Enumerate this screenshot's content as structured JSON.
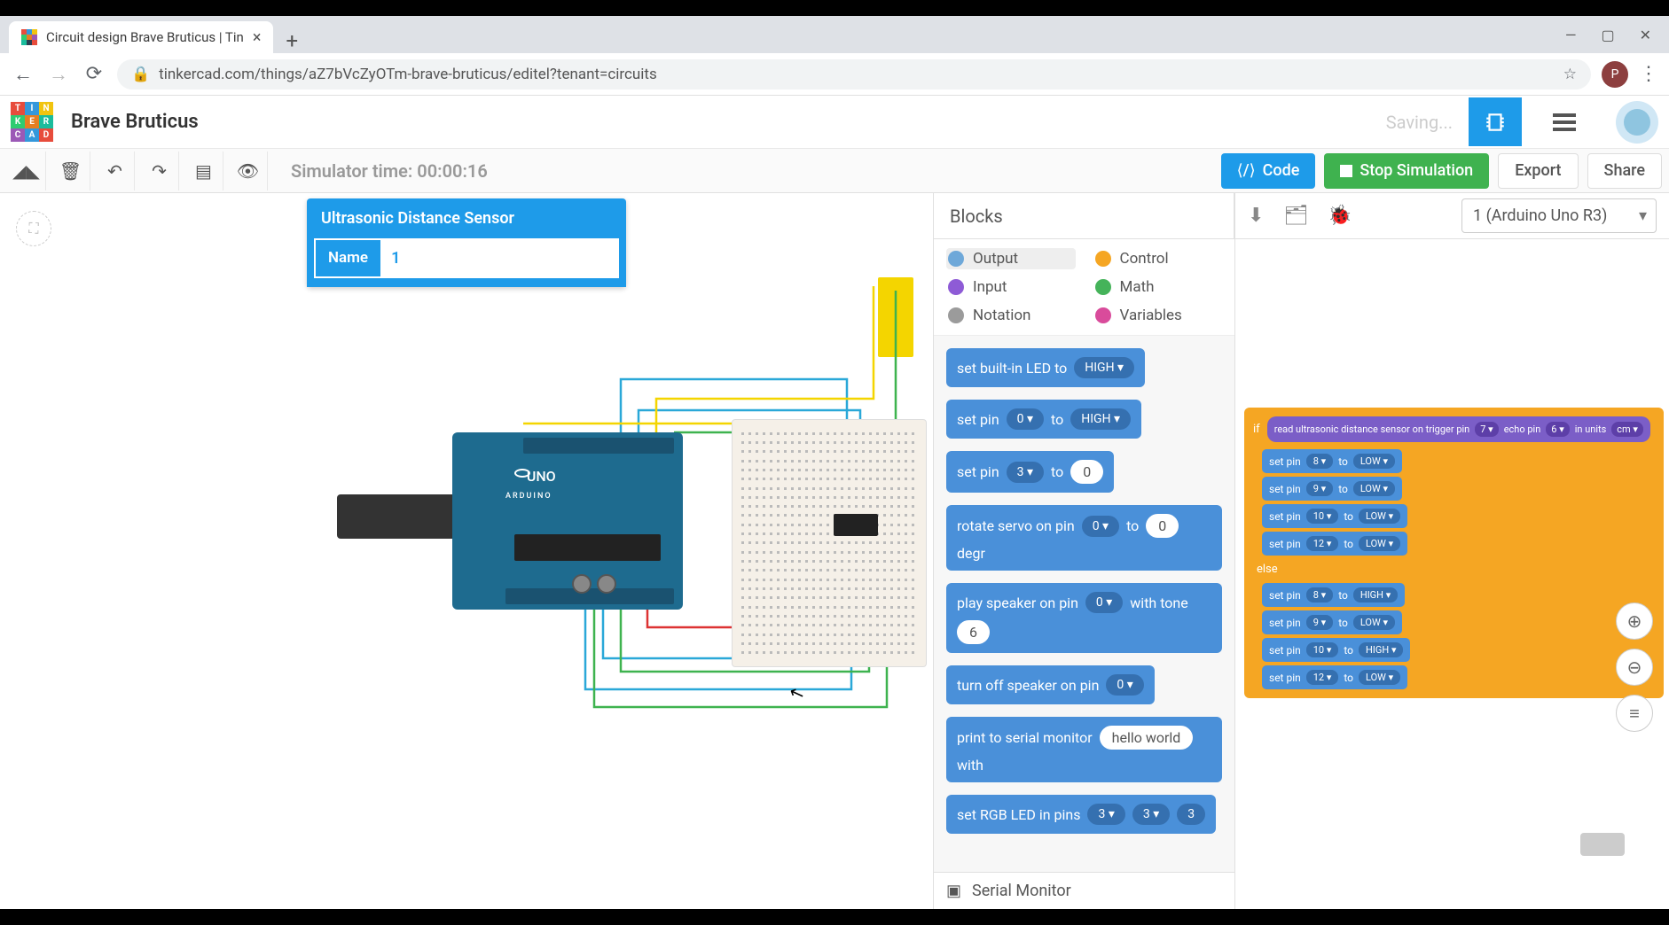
{
  "browser": {
    "tab_title": "Circuit design Brave Bruticus | Tin",
    "url": "tinkercad.com/things/aZ7bVcZyOTm-brave-bruticus/editel?tenant=circuits",
    "avatar_letter": "P"
  },
  "header": {
    "doc_title": "Brave Bruticus",
    "saving": "Saving..."
  },
  "toolbar": {
    "sim_time": "Simulator time: 00:00:16",
    "code_btn": "Code",
    "stop_btn": "Stop Simulation",
    "export_btn": "Export",
    "share_btn": "Share"
  },
  "inspector": {
    "title": "Ultrasonic Distance Sensor",
    "field_label": "Name",
    "field_value": "1"
  },
  "arduino": {
    "label": "UNO",
    "sub": "ARDUINO"
  },
  "code_panel": {
    "title": "Blocks",
    "categories": [
      {
        "name": "Output",
        "color": "#6ea8d9"
      },
      {
        "name": "Control",
        "color": "#f5a623"
      },
      {
        "name": "Input",
        "color": "#8e5bd6"
      },
      {
        "name": "Math",
        "color": "#45b35a"
      },
      {
        "name": "Notation",
        "color": "#9b9b9b"
      },
      {
        "name": "Variables",
        "color": "#d94b9b"
      }
    ],
    "blocks": [
      {
        "txt": "set built-in LED to",
        "pills": [
          "HIGH ▾"
        ]
      },
      {
        "txt": "set pin",
        "pills": [
          "0 ▾",
          "to",
          "HIGH ▾"
        ]
      },
      {
        "txt": "set pin",
        "pills": [
          "3 ▾",
          "to"
        ],
        "white": "0"
      },
      {
        "txt": "rotate servo on pin",
        "pills": [
          "0 ▾",
          "to"
        ],
        "white": "0",
        "tail": "degr"
      },
      {
        "txt": "play speaker on pin",
        "pills": [
          "0 ▾",
          "with tone"
        ],
        "white": "6"
      },
      {
        "txt": "turn off speaker on pin",
        "pills": [
          "0 ▾"
        ]
      },
      {
        "txt": "print to serial monitor",
        "white": "hello world",
        "tail": "with"
      },
      {
        "txt": "set RGB LED in pins",
        "pills": [
          "3 ▾",
          "3 ▾",
          "3"
        ]
      }
    ],
    "serial_monitor": "Serial Monitor"
  },
  "script_panel": {
    "device": "1 (Arduino Uno R3)",
    "sensor_block": {
      "prefix": "read ultrasonic distance sensor on trigger pin",
      "trig": "7 ▾",
      "mid": "echo pin",
      "echo": "6 ▾",
      "tail": "in units",
      "units": "cm ▾"
    },
    "if_label": "if",
    "else_label": "else",
    "then_rows": [
      {
        "pin": "8 ▾",
        "val": "LOW ▾"
      },
      {
        "pin": "9 ▾",
        "val": "LOW ▾"
      },
      {
        "pin": "10 ▾",
        "val": "LOW ▾"
      },
      {
        "pin": "12 ▾",
        "val": "LOW ▾"
      }
    ],
    "else_rows": [
      {
        "pin": "8 ▾",
        "val": "HIGH ▾"
      },
      {
        "pin": "9 ▾",
        "val": "LOW ▾"
      },
      {
        "pin": "10 ▾",
        "val": "HIGH ▾"
      },
      {
        "pin": "12 ▾",
        "val": "LOW ▾"
      }
    ],
    "row_prefix": "set pin",
    "row_to": "to"
  }
}
